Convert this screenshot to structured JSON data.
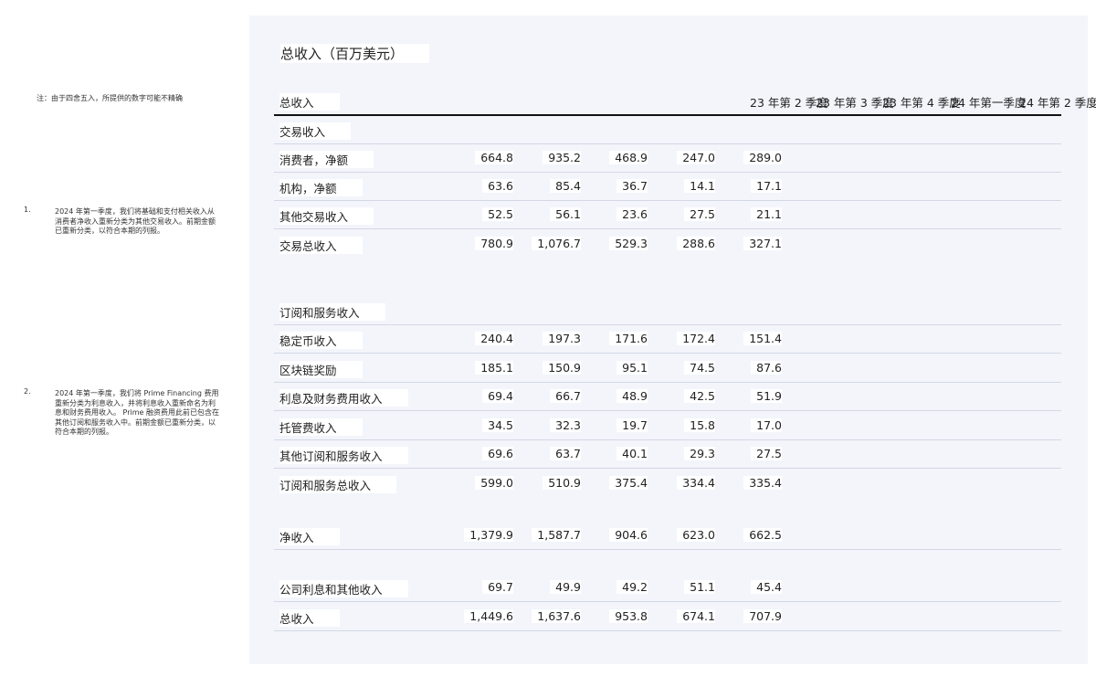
{
  "notes": {
    "rounding": "注：由于四舍五入，所提供的数字可能不精确",
    "footnotes": [
      {
        "num": "1.",
        "text": "2024 年第一季度，我们将基础和支付相关收入从消费者净收入重新分类为其他交易收入。前期金额已重新分类，以符合本期的列报。"
      },
      {
        "num": "2.",
        "text": "2024 年第一季度，我们将 Prime Financing 费用重新分类为利息收入，并将利息收入重新命名为利息和财务费用收入。 Prime 融资费用此前已包含在其他订阅和服务收入中。前期金额已重新分类，以符合本期的列报。"
      }
    ]
  },
  "panel": {
    "title": "总收入（百万美元）"
  },
  "table": {
    "header": {
      "label": "总收入",
      "periods": [
        "23 年第 2 季度",
        "23 年第 3 季度",
        "23 年第 4 季度",
        "24 年第一季度",
        "24 年第 2 季度"
      ]
    },
    "rows": [
      {
        "label": "交易收入",
        "values": []
      },
      {
        "label": "消费者，净额",
        "values": [
          "289.0",
          "247.0",
          "468.9",
          "935.2",
          "664.8"
        ]
      },
      {
        "label": "机构，净额",
        "values": [
          "17.1",
          "14.1",
          "36.7",
          "85.4",
          "63.6"
        ]
      },
      {
        "label": "其他交易收入",
        "values": [
          "21.1",
          "27.5",
          "23.6",
          "56.1",
          "52.5"
        ]
      },
      {
        "label": "交易总收入",
        "values": [
          "327.1",
          "288.6",
          "529.3",
          "1,076.7",
          "780.9"
        ]
      },
      {
        "label": "订阅和服务收入",
        "values": []
      },
      {
        "label": "稳定币收入",
        "values": [
          "151.4",
          "172.4",
          "171.6",
          "197.3",
          "240.4"
        ]
      },
      {
        "label": "区块链奖励",
        "values": [
          "87.6",
          "74.5",
          "95.1",
          "150.9",
          "185.1"
        ]
      },
      {
        "label": "利息及财务费用收入",
        "values": [
          "51.9",
          "42.5",
          "48.9",
          "66.7",
          "69.4"
        ]
      },
      {
        "label": "托管费收入",
        "values": [
          "17.0",
          "15.8",
          "19.7",
          "32.3",
          "34.5"
        ]
      },
      {
        "label": "其他订阅和服务收入",
        "values": [
          "27.5",
          "29.3",
          "40.1",
          "63.7",
          "69.6"
        ]
      },
      {
        "label": "订阅和服务总收入",
        "values": [
          "335.4",
          "334.4",
          "375.4",
          "510.9",
          "599.0"
        ]
      },
      {
        "label": "净收入",
        "values": [
          "662.5",
          "623.0",
          "904.6",
          "1,587.7",
          "1,379.9"
        ]
      },
      {
        "label": "公司利息和其他收入",
        "values": [
          "45.4",
          "51.1",
          "49.2",
          "49.9",
          "69.7"
        ]
      },
      {
        "label": "总收入",
        "values": [
          "707.9",
          "674.1",
          "953.8",
          "1,637.6",
          "1,449.6"
        ]
      }
    ]
  }
}
